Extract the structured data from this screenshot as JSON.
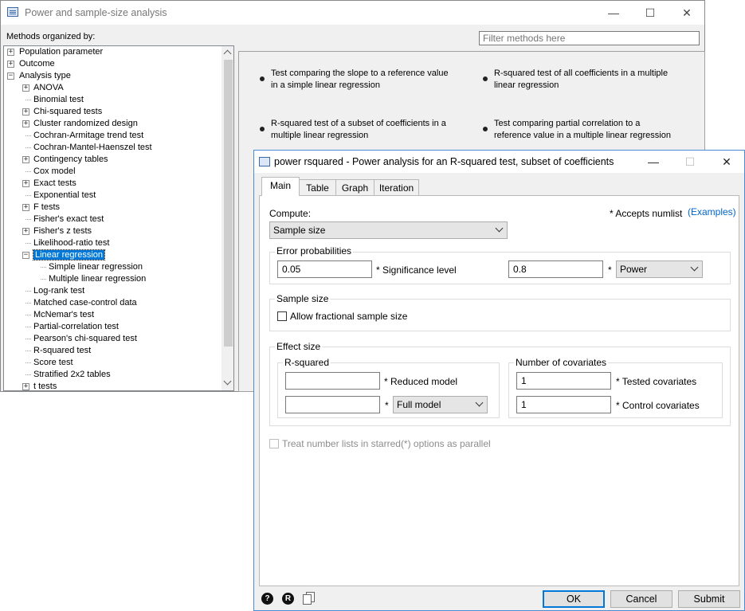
{
  "main_window": {
    "title": "Power and sample-size analysis",
    "controls": {
      "minimize": "—",
      "maximize": "☐",
      "close": "✕"
    },
    "methods_label": "Methods organized by:",
    "filter_placeholder": "Filter methods here",
    "tree": {
      "top": [
        {
          "label": "Population parameter",
          "expander": "+"
        },
        {
          "label": "Outcome",
          "expander": "+"
        },
        {
          "label": "Analysis type",
          "expander": "−"
        }
      ],
      "analysis_types": [
        {
          "label": "ANOVA",
          "expander": "+"
        },
        {
          "label": "Binomial test",
          "expander": ""
        },
        {
          "label": "Chi-squared tests",
          "expander": "+"
        },
        {
          "label": "Cluster randomized design",
          "expander": "+"
        },
        {
          "label": "Cochran-Armitage trend test",
          "expander": ""
        },
        {
          "label": "Cochran-Mantel-Haenszel test",
          "expander": ""
        },
        {
          "label": "Contingency tables",
          "expander": "+"
        },
        {
          "label": "Cox model",
          "expander": ""
        },
        {
          "label": "Exact tests",
          "expander": "+"
        },
        {
          "label": "Exponential test",
          "expander": ""
        },
        {
          "label": "F tests",
          "expander": "+"
        },
        {
          "label": "Fisher's exact test",
          "expander": ""
        },
        {
          "label": "Fisher's z tests",
          "expander": "+"
        },
        {
          "label": "Likelihood-ratio test",
          "expander": ""
        },
        {
          "label": "Linear regression",
          "expander": "−",
          "selected": true
        },
        {
          "label": "Simple linear regression",
          "expander": "",
          "child": true
        },
        {
          "label": "Multiple linear regression",
          "expander": "",
          "child": true
        },
        {
          "label": "Log-rank test",
          "expander": ""
        },
        {
          "label": "Matched case-control data",
          "expander": ""
        },
        {
          "label": "McNemar's test",
          "expander": ""
        },
        {
          "label": "Partial-correlation test",
          "expander": ""
        },
        {
          "label": "Pearson's chi-squared test",
          "expander": ""
        },
        {
          "label": "R-squared test",
          "expander": ""
        },
        {
          "label": "Score test",
          "expander": ""
        },
        {
          "label": "Stratified 2x2 tables",
          "expander": ""
        },
        {
          "label": "t tests",
          "expander": "+"
        }
      ]
    },
    "methods": [
      "Test comparing the slope to a reference value in a simple linear regression",
      "R-squared test of all coefficients in a multiple linear regression",
      "R-squared test of a subset of coefficients in a multiple linear regression",
      "Test comparing partial correlation to a reference value in a multiple linear regression"
    ]
  },
  "dialog": {
    "title": "power rsquared - Power analysis for an R-squared test, subset of coefficients",
    "controls": {
      "minimize": "—",
      "maximize": "☐",
      "close": "✕"
    },
    "tabs": [
      "Main",
      "Table",
      "Graph",
      "Iteration"
    ],
    "compute_label": "Compute:",
    "compute_value": "Sample size",
    "accepts_numlist": "* Accepts numlist",
    "examples_link": "(Examples)",
    "error_prob": {
      "title": "Error probabilities",
      "alpha_value": "0.05",
      "alpha_label": "* Significance level",
      "power_value": "0.8",
      "star": "*",
      "power_select": "Power"
    },
    "sample_size": {
      "title": "Sample size",
      "fractional_label": "Allow fractional sample size"
    },
    "effect_size": {
      "title": "Effect size",
      "rsq_title": "R-squared",
      "reduced_value": "",
      "reduced_label": "* Reduced model",
      "full_value": "",
      "star": "*",
      "full_select": "Full model",
      "cov_title": "Number of covariates",
      "tested_value": "1",
      "tested_label": "* Tested covariates",
      "control_value": "1",
      "control_label": "* Control covariates"
    },
    "parallel_label": "Treat number lists in starred(*) options as parallel",
    "footer": {
      "help_icon": "?",
      "r_icon": "R",
      "ok": "OK",
      "cancel": "Cancel",
      "submit": "Submit"
    }
  }
}
